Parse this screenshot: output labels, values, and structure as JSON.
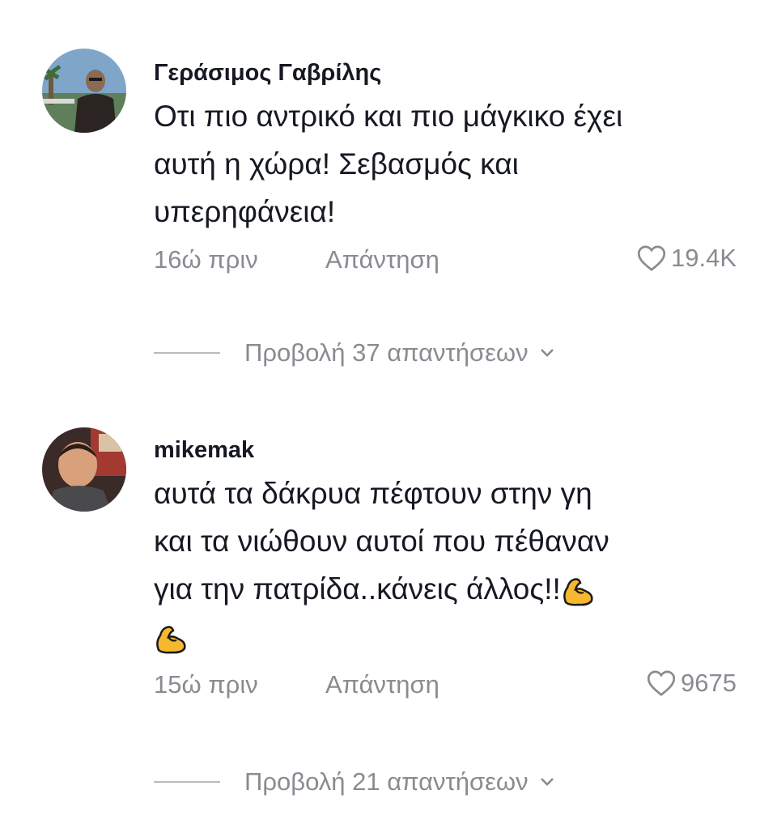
{
  "comments": [
    {
      "username": "Γεράσιμος Γαβρίλης",
      "text_lines": [
        "Οτι πιο αντρικό και πιο μάγκικο έχει",
        "αυτή η χώρα! Σεβασμός και",
        "υπερηφάνεια!"
      ],
      "time": "16ώ πριν",
      "reply_label": "Απάντηση",
      "likes": "19.4K",
      "view_replies": "Προβολή 37 απαντήσεων"
    },
    {
      "username": "mikemak",
      "text_lines": [
        "αυτά τα δάκρυα πέφτουν στην γη",
        "και τα νιώθουν αυτοί που πέθαναν",
        "για την πατρίδα..κάνεις άλλος!!"
      ],
      "emoji": "flexed-biceps-icon",
      "time": "15ώ πριν",
      "reply_label": "Απάντηση",
      "likes": "9675",
      "view_replies": "Προβολή 21 απαντήσεων"
    }
  ],
  "colors": {
    "text": "#161823",
    "secondary": "#8a8b91",
    "emoji": "#f5b82e"
  }
}
